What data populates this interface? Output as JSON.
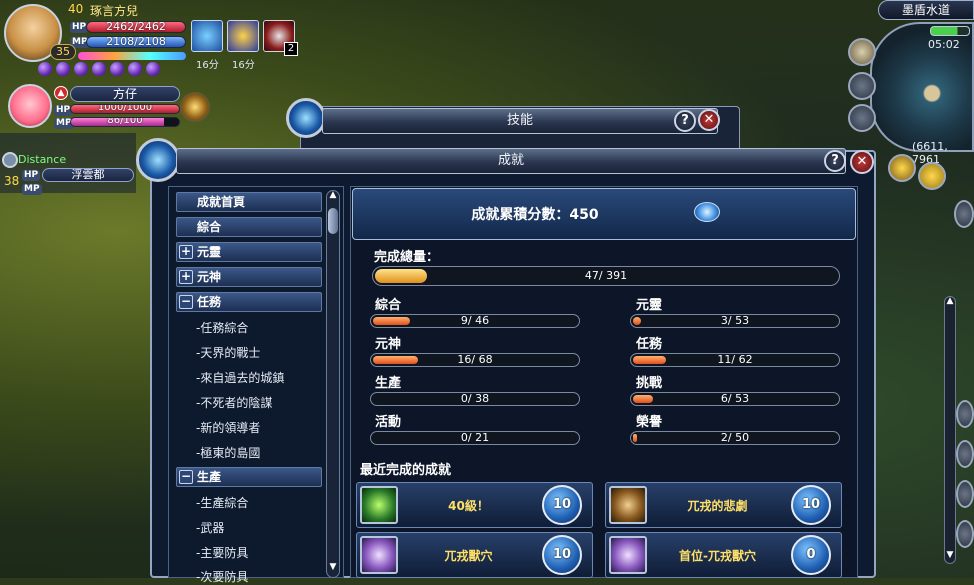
{
  "player": {
    "level": "40",
    "name": "琢言方兒",
    "hp_tag": "HP",
    "mp_tag": "MP",
    "hp": "2462/2462",
    "mp": "2108/2108",
    "hp_frac": 1.0,
    "mp_frac": 1.0,
    "badge_level": "35"
  },
  "buffs": [
    {
      "time": "16分"
    },
    {
      "time": "16分"
    },
    {
      "count": "2"
    }
  ],
  "pet": {
    "name": "方仔",
    "hp": "1000/1000",
    "mp": "86/100",
    "hp_frac": 1.0,
    "mp_frac": 0.86
  },
  "party": {
    "distance_label": "Distance",
    "level": "38",
    "name": "浮雲都",
    "hp_tag": "HP",
    "mp_tag": "MP"
  },
  "minimap": {
    "location": "墨盾水道",
    "time": "05:02",
    "coords": "(6611, 7961"
  },
  "skill_window": {
    "title": "技能"
  },
  "achievement_window": {
    "title": "成就",
    "total_score_label": "成就累積分數：450",
    "overall_label": "完成總量：",
    "overall_value": "47/ 391",
    "overall_frac": 0.1202,
    "categories": [
      {
        "name": "綜合",
        "value": "9/  46",
        "frac": 0.1957
      },
      {
        "name": "元靈",
        "value": "3/  53",
        "frac": 0.0566
      },
      {
        "name": "元神",
        "value": "16/  68",
        "frac": 0.2353
      },
      {
        "name": "任務",
        "value": "11/  62",
        "frac": 0.1774
      },
      {
        "name": "生產",
        "value": "0/  38",
        "frac": 0.0
      },
      {
        "name": "挑戰",
        "value": "6/  53",
        "frac": 0.1132
      },
      {
        "name": "活動",
        "value": "0/  21",
        "frac": 0.0
      },
      {
        "name": "榮譽",
        "value": "2/  50",
        "frac": 0.04
      }
    ],
    "recent_label": "最近完成的成就",
    "recent": [
      {
        "title": "40級！",
        "points": "10",
        "icon": "level-40-icon"
      },
      {
        "title": "兀戎的悲劇",
        "points": "10",
        "icon": "creature-silhouette-icon"
      },
      {
        "title": "兀戎獸穴",
        "points": "10",
        "icon": "crystal-icon"
      },
      {
        "title": "首位-兀戎獸穴",
        "points": "0",
        "icon": "crystal-icon"
      }
    ],
    "nav": {
      "home": "成就首頁",
      "general": "綜合",
      "spirit": "元靈",
      "deity": "元神",
      "quest": "任務",
      "quest_subs": [
        "-任務綜合",
        "-天界的戰士",
        "-來自過去的城鎮",
        "-不死者的陰謀",
        "-新的領導者",
        "-極東的島國"
      ],
      "production": "生產",
      "production_subs": [
        "-生產綜合",
        "-武器",
        "-主要防具",
        "-次要防具"
      ]
    }
  },
  "colors": {
    "accent": "#ffe066",
    "bar_orange": "#e0501c",
    "hp_red": "#d8324a",
    "mp_blue": "#3a78d8"
  }
}
